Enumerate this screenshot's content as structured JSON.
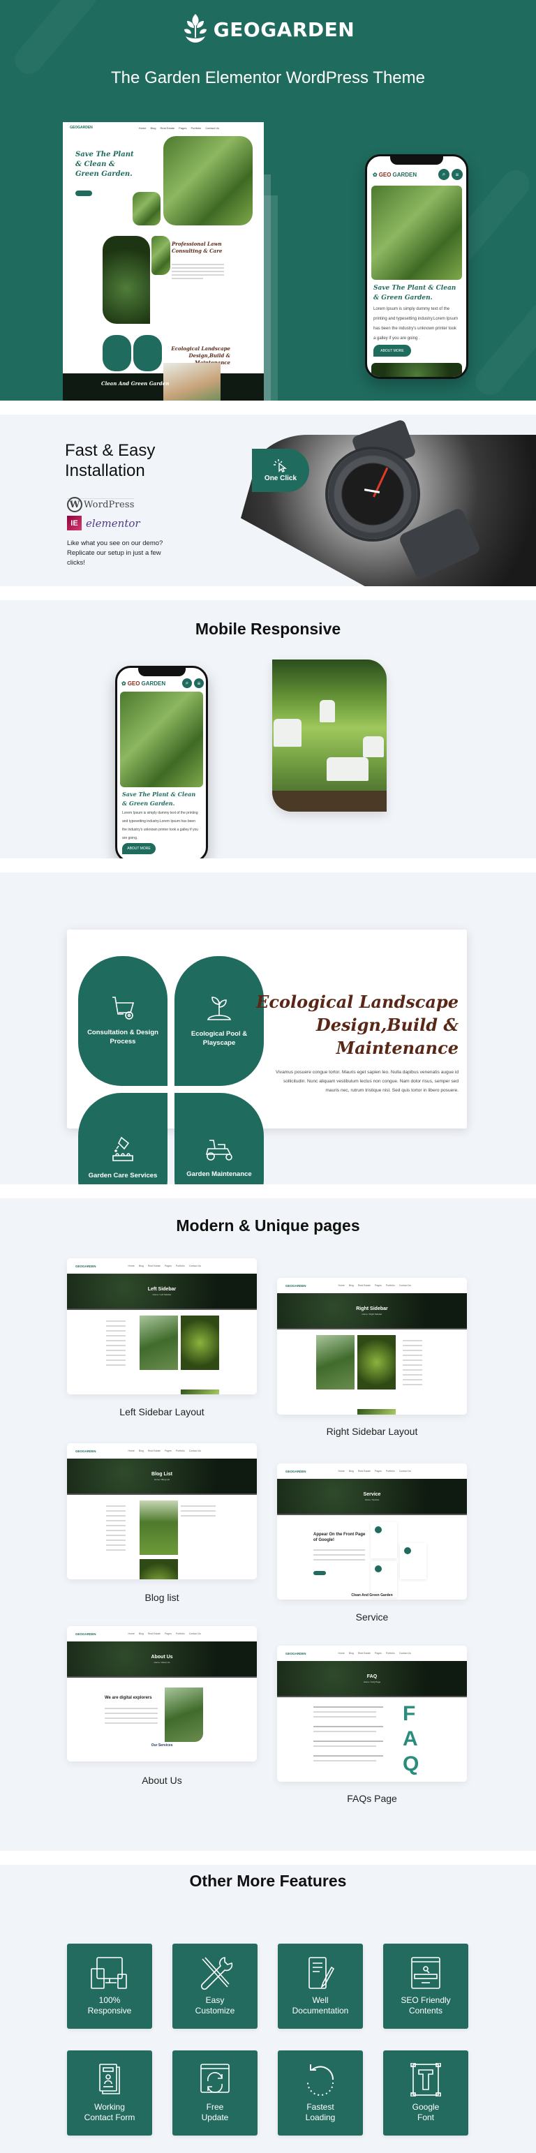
{
  "hero": {
    "brand_name": "GEOGARDEN",
    "subtitle": "The Garden Elementor WordPress Theme",
    "bg_color": "#1f6b5e",
    "desktop_mockup": {
      "nav": [
        "Home",
        "Blog",
        "Real Estate",
        "Pages",
        "Portfolio",
        "Contact Us"
      ],
      "logo": "GEOGARDEN",
      "hero_title": "Save The Plant & Clean & Green Garden.",
      "section2_title": "Professional Lawn Consulting & Care",
      "section3_title": "Ecological Landscape Design,Build & Maintenance",
      "footer_title": "Clean And Green Garden"
    },
    "phone_mockup": {
      "logo_geo": "GEO",
      "logo_garden": "GARDEN",
      "title": "Save The Plant & Clean & Green Garden.",
      "text": "Lorem Ipsum is simply dummy text of the printing and typesetting industry.Lorem Ipsum has been the industry's unknown printer took a galley if you are going .",
      "button": "ABOUT MORE"
    }
  },
  "install": {
    "title_line1": "Fast & Easy",
    "title_line2": "Installation",
    "wordpress_label": "WordPress",
    "elementor_label": "elementor",
    "description": "Like what you see on our demo? Replicate our setup in just a few clicks!",
    "badge_label": "One Click"
  },
  "mobile": {
    "title": "Mobile Responsive",
    "phone": {
      "logo_geo": "GEO",
      "logo_garden": "GARDEN",
      "title": "Save The Plant & Clean & Green Garden.",
      "text": "Lorem Ipsum is simply dummy text of the printing and typesetting industry.Lorem Ipsum has been the industry's unknown printer took a galley if you are going.",
      "button": "ABOUT MORE"
    }
  },
  "eco": {
    "tiles": [
      {
        "label": "Consultation & Design Process",
        "icon": "wheelbarrow-icon"
      },
      {
        "label": "Ecological Pool & Playscape",
        "icon": "sprout-icon"
      },
      {
        "label": "Garden Care Services",
        "icon": "watering-can-icon"
      },
      {
        "label": "Garden Maintenance",
        "icon": "lawn-mower-icon"
      }
    ],
    "title": "Ecological Landscape Design,Build & Maintenance",
    "description": "Vivamus posuere congue tortor. Mauris eget sapien leo. Nulla dapibus venenatis augue id sollicitudin. Nunc aliquam vestibulum lectus non congue. Nam dolor risus, semper sed mauris nec, rutrum tristique nisl. Sed quis tortor in libero posuere."
  },
  "pages": {
    "title": "Modern & Unique pages",
    "nav": [
      "Home",
      "Blog",
      "Real Estate",
      "Pages",
      "Portfolio",
      "Contact Us"
    ],
    "logo": "GEOGARDEN",
    "items": [
      {
        "caption": "Left Sidebar Layout",
        "banner": "Left Sidebar",
        "crumb": "Home / Left Sidebar"
      },
      {
        "caption": "Right Sidebar Layout",
        "banner": "Right Sidebar",
        "crumb": "Home / Right Sidebar"
      },
      {
        "caption": "Blog list",
        "banner": "Blog List",
        "crumb": "Home / Blog List"
      },
      {
        "caption": "Service",
        "banner": "Service",
        "crumb": "Home / Service",
        "heading": "Appear On the Front Page of Google!",
        "sub": "Clean And Green Garden"
      },
      {
        "caption": "About Us",
        "banner": "About Us",
        "crumb": "Home / About Us",
        "heading": "We are digital explorers",
        "sub": "Our Services"
      },
      {
        "caption": "FAQs Page",
        "banner": "FAQ",
        "crumb": "Home / FAQ Page"
      }
    ]
  },
  "features": {
    "title": "Other More Features",
    "items": [
      {
        "line1": "100%",
        "line2": "Responsive",
        "icon": "devices-icon"
      },
      {
        "line1": "Easy",
        "line2": "Customize",
        "icon": "tools-icon"
      },
      {
        "line1": "Well",
        "line2": "Documentation",
        "icon": "document-pen-icon"
      },
      {
        "line1": "SEO Friendly",
        "line2": "Contents",
        "icon": "seo-search-icon"
      },
      {
        "line1": "Working",
        "line2": "Contact Form",
        "icon": "contact-form-icon"
      },
      {
        "line1": "Free",
        "line2": "Update",
        "icon": "update-icon"
      },
      {
        "line1": "Fastest",
        "line2": "Loading",
        "icon": "loading-icon"
      },
      {
        "line1": "Google",
        "line2": "Font",
        "icon": "font-icon"
      }
    ],
    "tile_color": "#236b5f"
  }
}
